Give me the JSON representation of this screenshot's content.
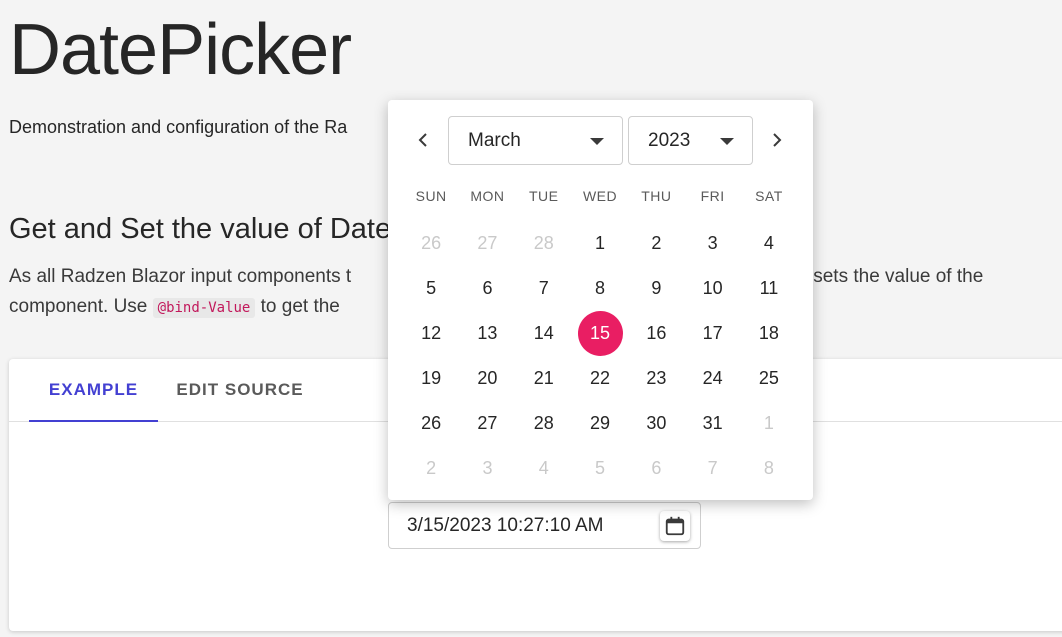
{
  "page": {
    "title": "DatePicker",
    "subtitle": "Demonstration and configuration of the Ra",
    "section_title": "Get and Set the value of Date",
    "desc_line1": "As all Radzen Blazor input components t",
    "desc_line1_tail": "ts and sets the value of the",
    "desc_line2_pre": "component. Use",
    "desc_code": "@bind-Value",
    "desc_line2_post": "to get the"
  },
  "tabs": [
    {
      "label": "EXAMPLE",
      "active": true
    },
    {
      "label": "EDIT SOURCE",
      "active": false
    }
  ],
  "date_input": {
    "value": "3/15/2023 10:27:10 AM"
  },
  "calendar": {
    "month": "March",
    "year": "2023",
    "weekdays": [
      "SUN",
      "MON",
      "TUE",
      "WED",
      "THU",
      "FRI",
      "SAT"
    ],
    "weeks": [
      [
        {
          "d": "26",
          "other": true
        },
        {
          "d": "27",
          "other": true
        },
        {
          "d": "28",
          "other": true
        },
        {
          "d": "1"
        },
        {
          "d": "2"
        },
        {
          "d": "3"
        },
        {
          "d": "4"
        }
      ],
      [
        {
          "d": "5"
        },
        {
          "d": "6"
        },
        {
          "d": "7"
        },
        {
          "d": "8"
        },
        {
          "d": "9"
        },
        {
          "d": "10"
        },
        {
          "d": "11"
        }
      ],
      [
        {
          "d": "12"
        },
        {
          "d": "13"
        },
        {
          "d": "14"
        },
        {
          "d": "15",
          "selected": true
        },
        {
          "d": "16"
        },
        {
          "d": "17"
        },
        {
          "d": "18"
        }
      ],
      [
        {
          "d": "19"
        },
        {
          "d": "20"
        },
        {
          "d": "21"
        },
        {
          "d": "22"
        },
        {
          "d": "23"
        },
        {
          "d": "24"
        },
        {
          "d": "25"
        }
      ],
      [
        {
          "d": "26"
        },
        {
          "d": "27"
        },
        {
          "d": "28"
        },
        {
          "d": "29"
        },
        {
          "d": "30"
        },
        {
          "d": "31"
        },
        {
          "d": "1",
          "other": true
        }
      ],
      [
        {
          "d": "2",
          "other": true
        },
        {
          "d": "3",
          "other": true
        },
        {
          "d": "4",
          "other": true
        },
        {
          "d": "5",
          "other": true
        },
        {
          "d": "6",
          "other": true
        },
        {
          "d": "7",
          "other": true
        },
        {
          "d": "8",
          "other": true
        }
      ]
    ]
  },
  "colors": {
    "accent": "#4340d2",
    "selected_day": "#e91e63"
  },
  "icons": {
    "prev": "chevron-left-icon",
    "next": "chevron-right-icon",
    "calendar": "calendar-icon"
  }
}
